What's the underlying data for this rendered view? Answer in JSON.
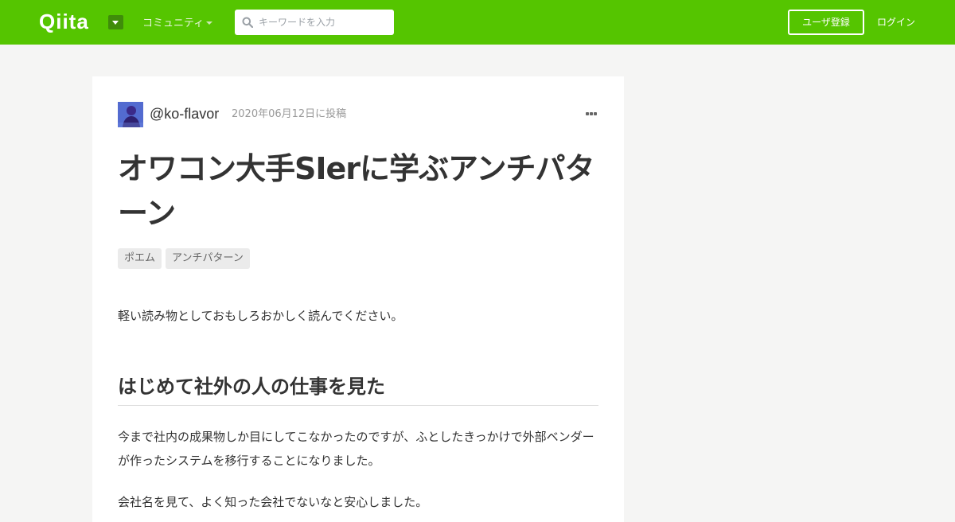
{
  "header": {
    "logo": "Qiita",
    "community_label": "コミュニティ",
    "search_placeholder": "キーワードを入力",
    "signup_label": "ユーザ登録",
    "login_label": "ログイン",
    "colors": {
      "bar": "#55c500"
    }
  },
  "article": {
    "author": "@ko-flavor",
    "posted": "2020年06月12日に投稿",
    "title": "オワコン大手SIerに学ぶアンチパターン",
    "tags": [
      "ポエム",
      "アンチパターン"
    ],
    "intro": "軽い読み物としておもしろおかしく読んでください。",
    "section_heading": "はじめて社外の人の仕事を見た",
    "paragraph": "今まで社内の成果物しか目にしてこなかったのですが、ふとしたきっかけで外部ベンダーが作ったシステムを移行することになりました。",
    "paragraph_next": "会社名を見て、よく知った会社でないなと安心しました。"
  },
  "icons": {
    "search": "search-icon",
    "more": "more-horizontal-icon",
    "dropdown": "chevron-down-icon"
  }
}
